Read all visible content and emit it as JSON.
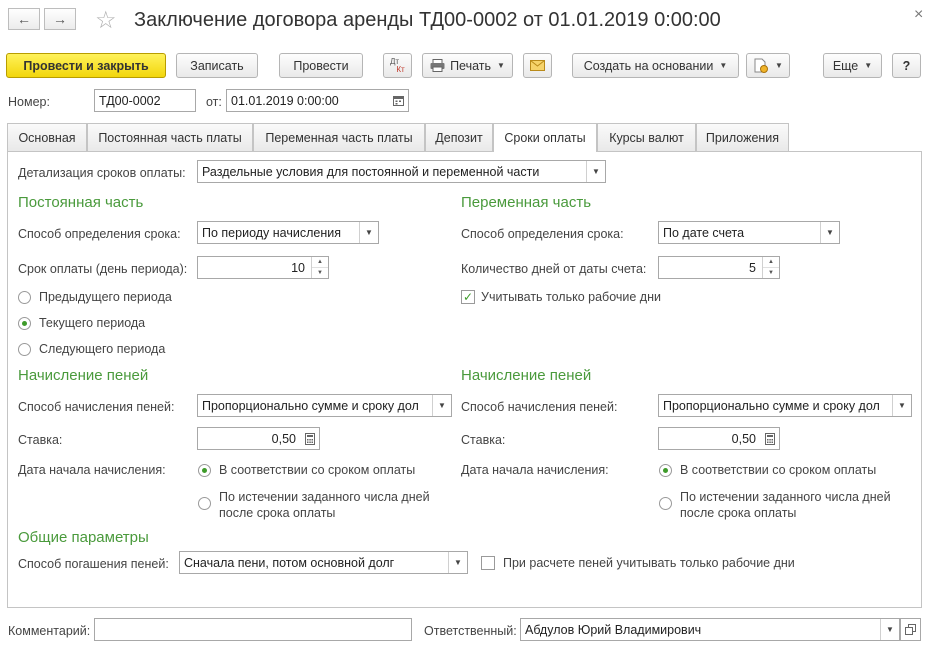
{
  "window": {
    "title": "Заключение договора аренды ТД00-0002 от 01.01.2019 0:00:00",
    "close": "×"
  },
  "nav": {
    "back": "←",
    "forward": "→",
    "favorite": "☆"
  },
  "toolbar": {
    "post_close": "Провести и закрыть",
    "write": "Записать",
    "post": "Провести",
    "dtkt_top": "Дт",
    "dtkt_bottom": "Кт",
    "print": "Печать",
    "create_based": "Создать на основании",
    "more": "Еще",
    "help": "?"
  },
  "header": {
    "number_label": "Номер:",
    "number_value": "ТД00-0002",
    "date_label": "от:",
    "date_value": "01.01.2019  0:00:00"
  },
  "tabs": [
    {
      "label": "Основная"
    },
    {
      "label": "Постоянная часть платы"
    },
    {
      "label": "Переменная часть платы"
    },
    {
      "label": "Депозит"
    },
    {
      "label": "Сроки оплаты"
    },
    {
      "label": "Курсы валют"
    },
    {
      "label": "Приложения"
    }
  ],
  "detail": {
    "label": "Детализация сроков оплаты:",
    "value": "Раздельные условия для постоянной и переменной части"
  },
  "constant": {
    "title": "Постоянная часть",
    "method_label": "Способ определения срока:",
    "method_value": "По периоду начисления",
    "term_label": "Срок оплаты (день периода):",
    "term_value": "10",
    "radio_prev": "Предыдущего периода",
    "radio_curr": "Текущего периода",
    "radio_next": "Следующего периода",
    "selected": "current"
  },
  "variable": {
    "title": "Переменная часть",
    "method_label": "Способ определения срока:",
    "method_value": "По дате счета",
    "days_label": "Количество дней от даты счета:",
    "days_value": "5",
    "workdays_label": "Учитывать только рабочие дни",
    "workdays_checked": true
  },
  "penalty_left": {
    "title": "Начисление пеней",
    "method_label": "Способ начисления пеней:",
    "method_value": "Пропорционально сумме и сроку дол",
    "rate_label": "Ставка:",
    "rate_value": "0,50",
    "start_label": "Дата начала начисления:",
    "opt1": "В соответствии со сроком оплаты",
    "opt2_line1": "По истечении заданного числа дней",
    "opt2_line2": "после срока оплаты"
  },
  "penalty_right": {
    "title": "Начисление пеней",
    "method_label": "Способ начисления пеней:",
    "method_value": "Пропорционально сумме и сроку дол",
    "rate_label": "Ставка:",
    "rate_value": "0,50",
    "start_label": "Дата начала начисления:",
    "opt1": "В соответствии со сроком оплаты",
    "opt2_line1": "По истечении заданного числа дней",
    "opt2_line2": "после срока оплаты"
  },
  "general": {
    "title": "Общие параметры",
    "repay_label": "Способ погашения пеней:",
    "repay_value": "Сначала пени, потом основной долг",
    "workdays_label": "При расчете пеней учитывать только рабочие дни",
    "workdays_checked": false
  },
  "footer": {
    "comment_label": "Комментарий:",
    "comment_value": "",
    "responsible_label": "Ответственный:",
    "responsible_value": "Абдулов Юрий Владимирович"
  },
  "colors": {
    "accent_green": "#4a9a3c",
    "primary_yellow": "#f2d60c"
  }
}
